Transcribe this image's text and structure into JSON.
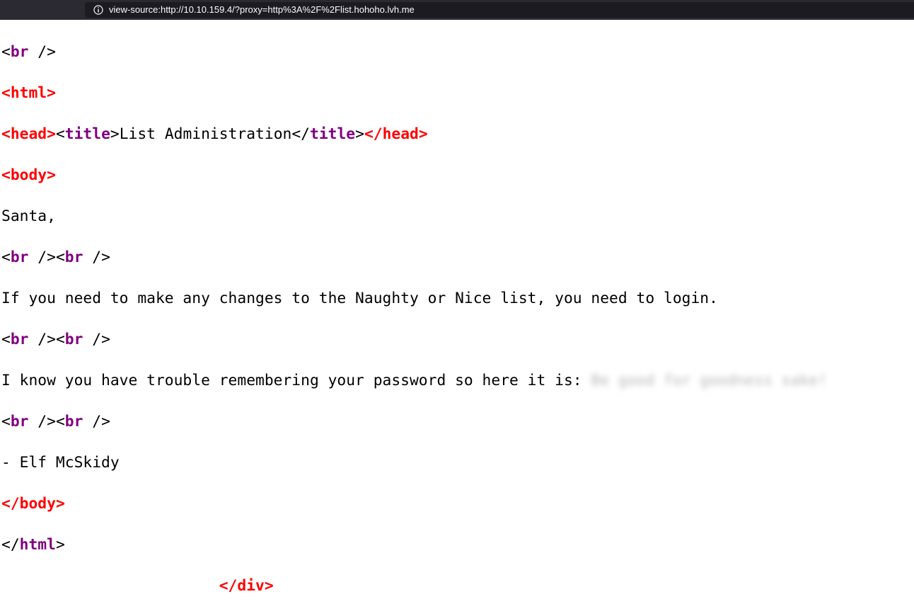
{
  "browser": {
    "url": "view-source:http://10.10.159.4/?proxy=http%3A%2F%2Flist.hohoho.lvh.me"
  },
  "source": {
    "br": "br",
    "html": "html",
    "head": "head",
    "title": "title",
    "body": "body",
    "div": "div",
    "title_text": "List Administration",
    "greeting": "Santa,",
    "line_login": "If you need to make any changes to the Naughty or Nice list, you need to login.",
    "line_password": "I know you have trouble remembering your password so here it is: ",
    "redacted_password": "Be good for goodness sake!",
    "signature": "- Elf McSkidy"
  },
  "colors": {
    "tag": "#800080",
    "tag_error": "#ff0000",
    "addressbar": "#2b2a33"
  }
}
